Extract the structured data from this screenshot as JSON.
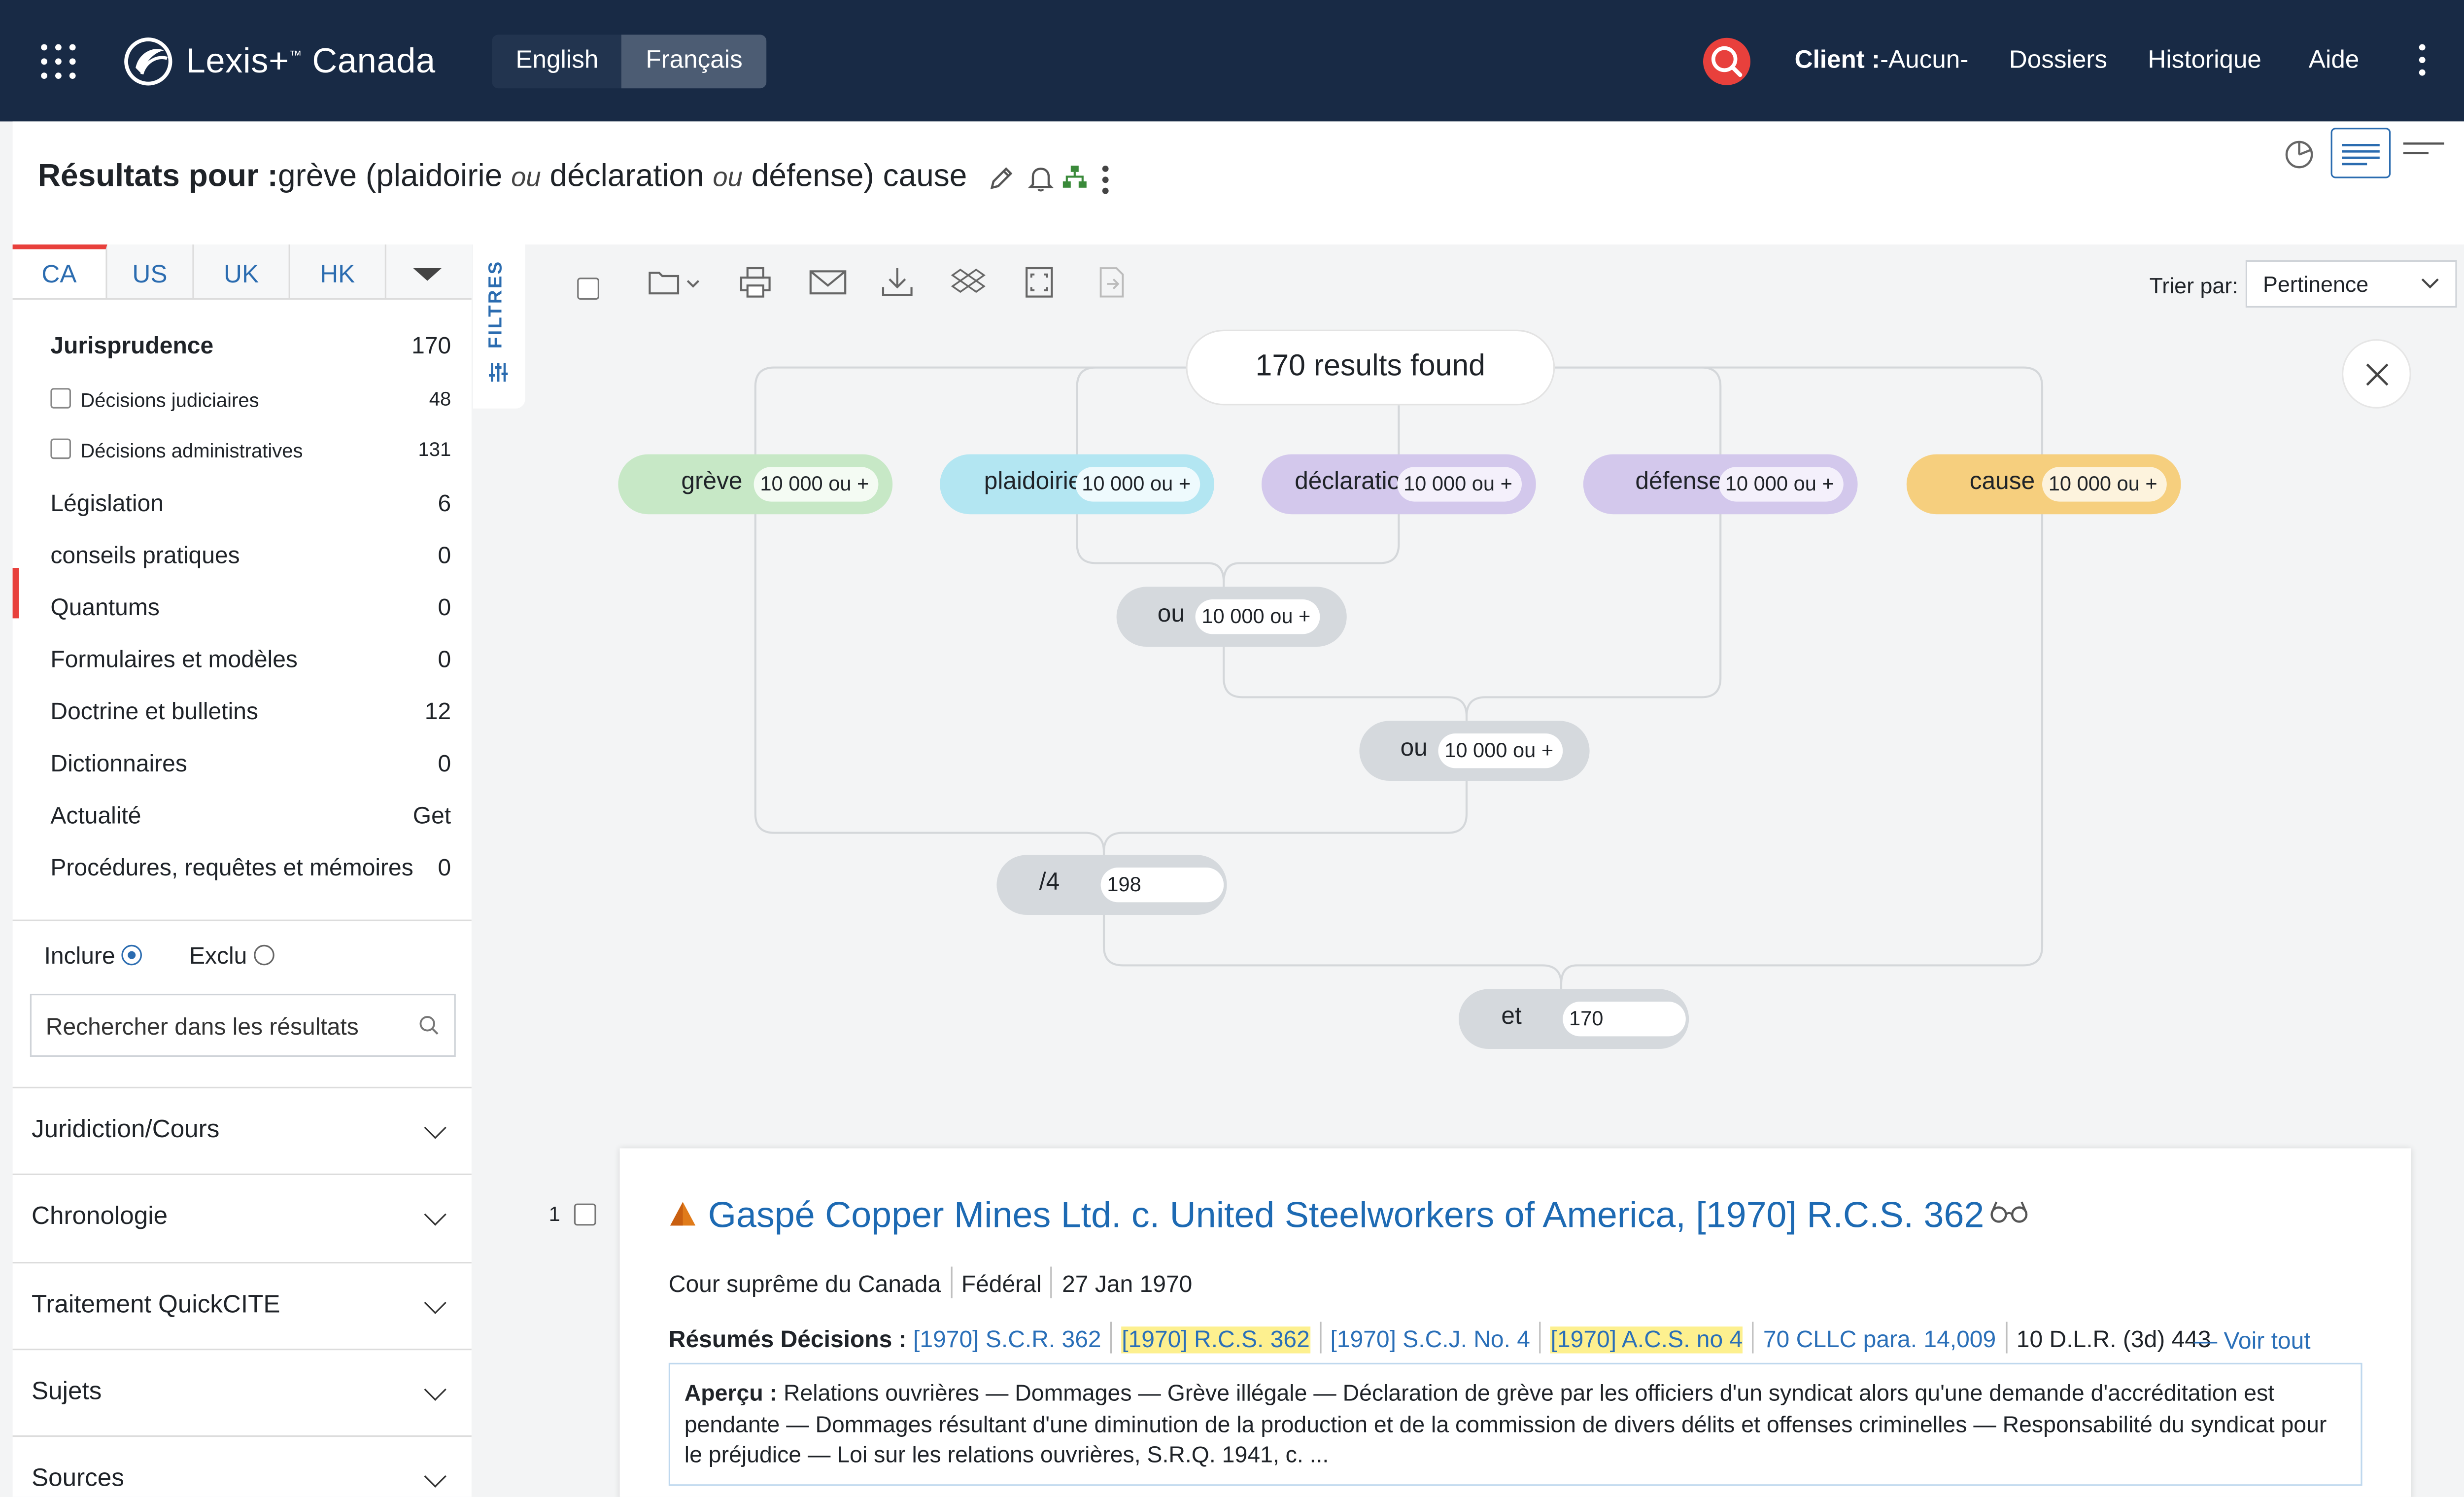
{
  "app": {
    "logo": "Lexis+",
    "logo_tm": "™",
    "region": "Canada",
    "languages": [
      "English",
      "Français"
    ],
    "active_language": "Français"
  },
  "topnav": {
    "client_label": "Client :",
    "client_value": "-Aucun-",
    "items": [
      "Dossiers",
      "Historique",
      "Aide"
    ]
  },
  "results_header": {
    "prefix": "Résultats pour :",
    "query": {
      "t1": "grève (",
      "t2": "plaidoirie ",
      "op1": "ou",
      "t3": " déclaration ",
      "op2": "ou",
      "t4": " défense",
      "t5": ") cause"
    }
  },
  "jurisdiction_tabs": [
    "CA",
    "US",
    "UK",
    "HK"
  ],
  "categories": [
    {
      "label": "Jurisprudence",
      "count": "170"
    },
    {
      "label": "Décisions judiciaires",
      "count": "48"
    },
    {
      "label": "Décisions administratives",
      "count": "131"
    },
    {
      "label": "Législation",
      "count": "6"
    },
    {
      "label": "conseils pratiques",
      "count": "0"
    },
    {
      "label": "Quantums",
      "count": "0"
    },
    {
      "label": "Formulaires et modèles",
      "count": "0"
    },
    {
      "label": "Doctrine et bulletins",
      "count": "12"
    },
    {
      "label": "Dictionnaires",
      "count": "0"
    },
    {
      "label": "Actualité",
      "count": "Get"
    },
    {
      "label": "Procédures, requêtes et mémoires",
      "count": "0"
    }
  ],
  "include_exclude": {
    "include": "Inclure",
    "exclude": "Exclu"
  },
  "search_within": {
    "placeholder": "Rechercher dans les résultats"
  },
  "filters": [
    "Juridiction/Cours",
    "Chronologie",
    "Traitement QuickCITE",
    "Sujets",
    "Sources"
  ],
  "filtres_tab": "FILTRES",
  "sort": {
    "label": "Trier par:",
    "value": "Pertinence"
  },
  "query_map": {
    "results_found": "170 results found",
    "terms": [
      {
        "label": "grève",
        "count": "10 000 ou +",
        "color": "#c7e8c6"
      },
      {
        "label": "plaidoirie",
        "count": "10 000 ou +",
        "color": "#b3e6f2"
      },
      {
        "label": "déclaration",
        "count": "10 000 ou +",
        "color": "#d3c8ec"
      },
      {
        "label": "défense",
        "count": "10 000 ou +",
        "color": "#d3c8ec"
      },
      {
        "label": "cause",
        "count": "10 000 ou +",
        "color": "#f6cf7e"
      }
    ],
    "operators": [
      {
        "label": "ou",
        "count": "10 000 ou +"
      },
      {
        "label": "ou",
        "count": "10 000 ou +"
      },
      {
        "label": "/4",
        "count": "198"
      },
      {
        "label": "et",
        "count": "170"
      }
    ]
  },
  "result": {
    "number": "1",
    "title": "Gaspé Copper Mines Ltd. c. United Steelworkers of America, [1970] R.C.S. 362",
    "court": "Cour suprême du Canada",
    "jurisdiction": "Fédéral",
    "date": "27 Jan 1970",
    "summaries_label": "Résumés Décisions :",
    "citations": [
      "[1970] S.C.R. 362",
      "[1970] R.C.S. 362",
      "[1970] S.C.J. No. 4",
      "[1970] A.C.S. no 4",
      "70 CLLC para. 14,009",
      "10 D.L.R. (3d) 443"
    ],
    "see_all": "— Voir tout",
    "overview_label": "Aperçu :",
    "overview": "Relations ouvrières — Dommages — Grève illégale — Déclaration de grève par les officiers d'un syndicat alors qu'une demande d'accréditation est pendante — Dommages résultant d'une diminution de la production et de la commission de divers délits et offenses criminelles — Responsabilité du syndicat pour le préjudice — Loi sur les relations ouvrières, S.R.Q. 1941, c. ..."
  }
}
